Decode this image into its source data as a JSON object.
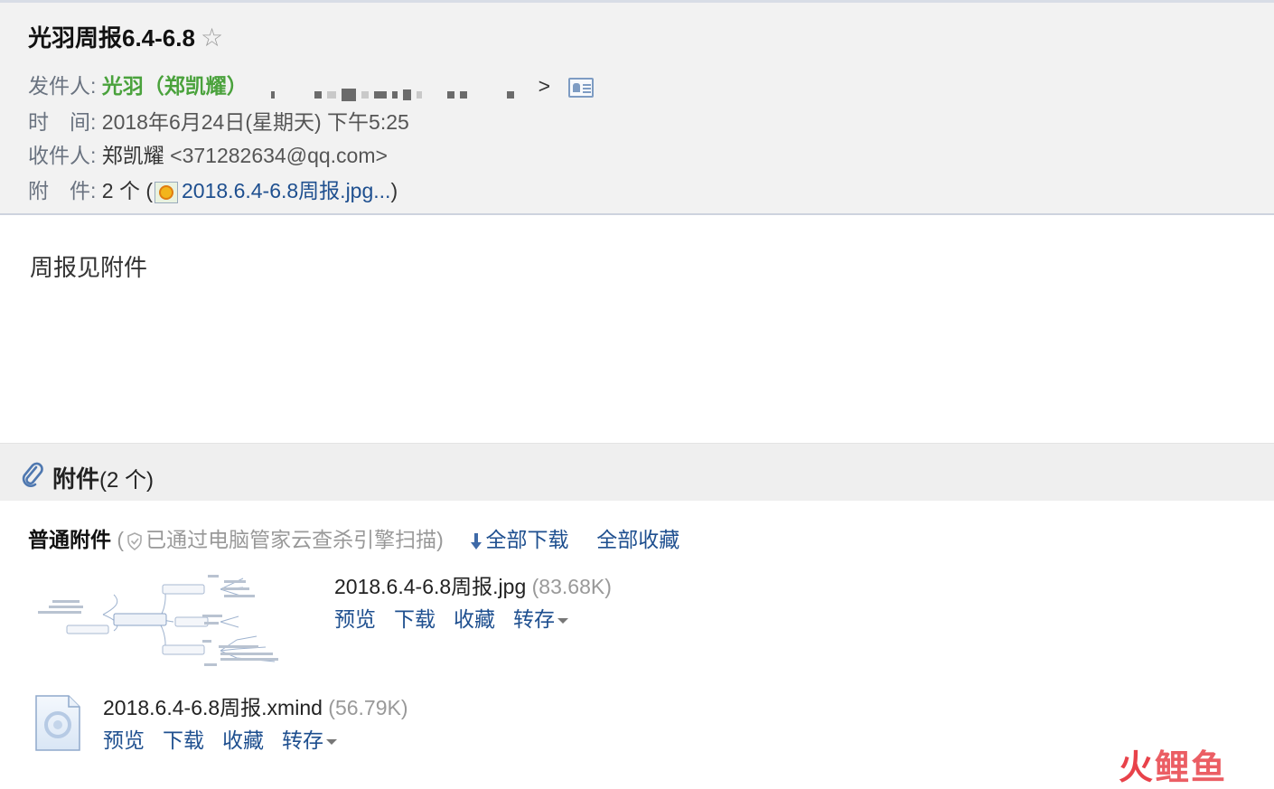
{
  "email": {
    "subject": "光羽周报6.4-6.8",
    "star_icon": "star-icon",
    "sender_label": "发件人:",
    "sender_name": "光羽（郑凯耀）",
    "sender_close": ">",
    "time_label": "时　间:",
    "time_value": "2018年6月24日(星期天) 下午5:25",
    "to_label": "收件人:",
    "to_name": "郑凯耀",
    "to_email": "<371282634@qq.com>",
    "att_label": "附　件:",
    "att_count": "2 个 (",
    "att_first": "2018.6.4-6.8周报.jpg...",
    "att_close": ")"
  },
  "body": {
    "text": "周报见附件"
  },
  "attachments": {
    "title": "附件",
    "count": "(2 个)",
    "normal_label": "普通附件",
    "scan_open": "(",
    "scan_text": "已通过电脑管家云查杀引擎扫描",
    "scan_close": ")",
    "download_all": "全部下载",
    "collect_all": "全部收藏",
    "files": [
      {
        "name": "2018.6.4-6.8周报.jpg",
        "size": "(83.68K)",
        "actions": [
          "预览",
          "下载",
          "收藏",
          "转存"
        ]
      },
      {
        "name": "2018.6.4-6.8周报.xmind",
        "size": "(56.79K)",
        "actions": [
          "预览",
          "下载",
          "收藏",
          "转存"
        ]
      }
    ]
  },
  "watermark": {
    "part1": "火",
    "part2": "鲤鱼"
  },
  "colors": {
    "sender_green": "#4aa23c",
    "link_blue": "#1e4f8f",
    "header_bg": "#f2f2f2"
  }
}
